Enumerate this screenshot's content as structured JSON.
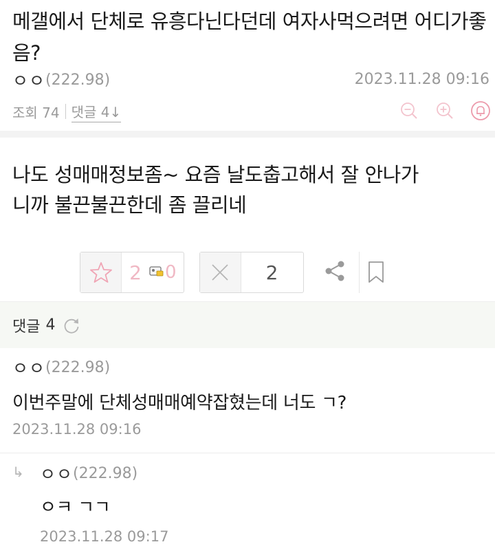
{
  "post": {
    "title": "메갤에서 단체로 유흥다닌다던데 여자사먹으려면 어디가좋음?",
    "author": "ㅇㅇ",
    "author_ip": "(222.98)",
    "date": "2023.11.28 09:16",
    "views_label": "조회 74",
    "comments_label": "댓글 4↓",
    "body_lines": [
      "나도 성매매정보좀~ 요즘 날도춥고해서 잘 안나가",
      "니까 불끈불끈한데 좀 끌리네"
    ]
  },
  "votes": {
    "up_count": "2",
    "fixed_count": "0",
    "down_count": "2"
  },
  "comments_section": {
    "title": "댓글",
    "count": "4"
  },
  "comments": [
    {
      "author": "ㅇㅇ",
      "author_ip": "(222.98)",
      "text": "이번주말에 단체성매매예약잡혔는데 너도 ㄱ?",
      "date": "2023.11.28 09:16"
    },
    {
      "reply_marker": "↳",
      "author": "ㅇㅇ",
      "author_ip": "(222.98)",
      "text": "ㅇㅋ ㄱㄱ",
      "date": "2023.11.28 09:17"
    }
  ],
  "colors": {
    "accent_pink": "#f0b8c4",
    "muted_gray": "#9a9a9a",
    "comments_header_bg": "#f6f8f4"
  }
}
